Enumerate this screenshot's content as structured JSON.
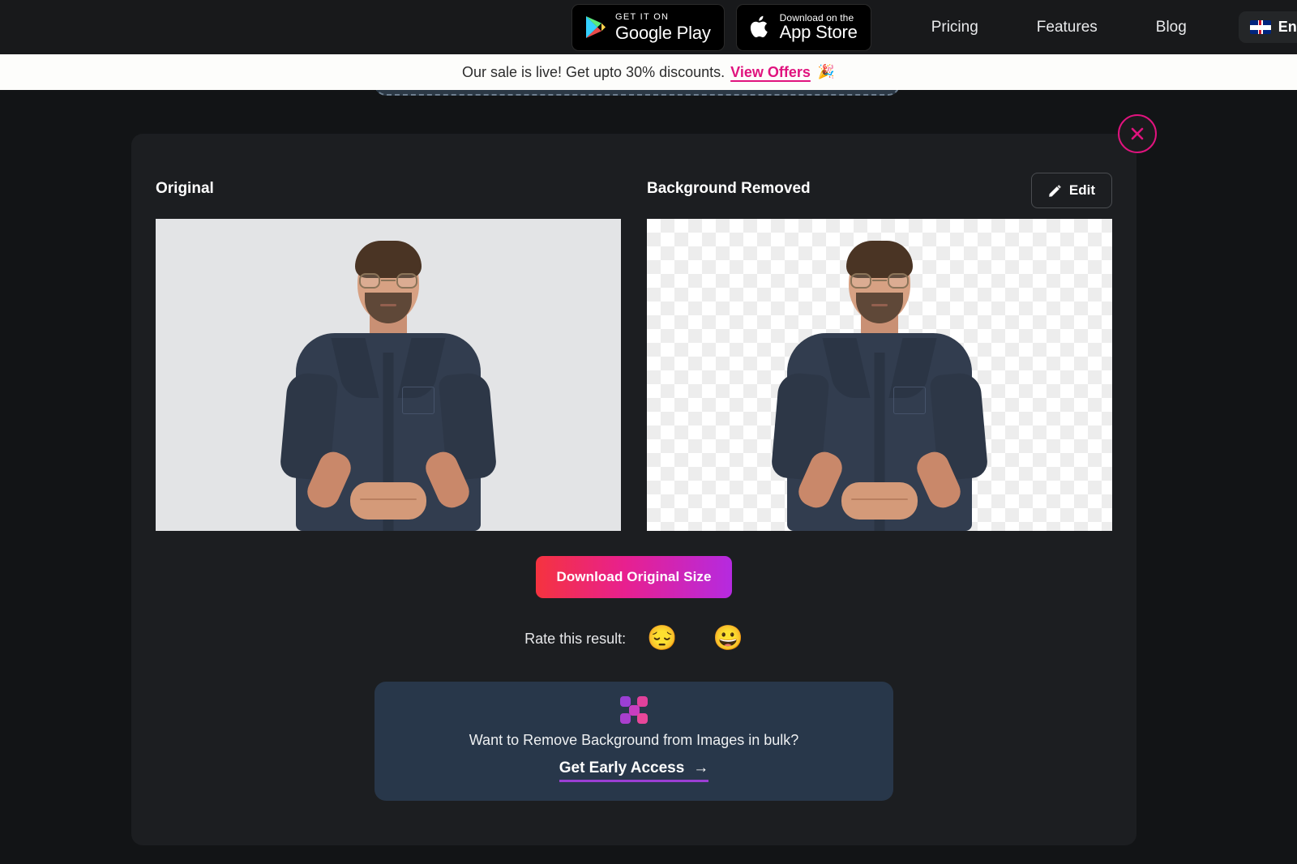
{
  "background": {
    "dropzone_text": "Want to Remove Background from Images in bulk?"
  },
  "topbar": {
    "google_play": {
      "small_label": "GET IT ON",
      "big_label": "Google Play",
      "icon": "google-play-icon"
    },
    "app_store": {
      "small_label": "Download on the",
      "big_label": "App Store",
      "icon": "apple-icon"
    },
    "nav": [
      {
        "label": "Pricing"
      },
      {
        "label": "Features"
      },
      {
        "label": "Blog"
      }
    ],
    "language": {
      "label": "English",
      "flag": "uk-flag-icon"
    }
  },
  "sale_banner": {
    "message": "Our sale is live! Get upto 30% discounts.",
    "link_label": "View Offers",
    "emoji": "🎉",
    "link_color": "#e0137e",
    "background": "#fdfdfb"
  },
  "panel": {
    "close_icon": "close-icon",
    "close_color": "#e0137e",
    "columns": {
      "original_title": "Original",
      "removed_title": "Background Removed"
    },
    "edit_button": {
      "label": "Edit",
      "icon": "pencil-icon"
    },
    "download_button": {
      "label": "Download Original Size",
      "gradient_from": "#f5333f",
      "gradient_to": "#b52ae0"
    },
    "rating": {
      "label": "Rate this result:",
      "options": [
        {
          "name": "sad-emoji",
          "glyph": "😔"
        },
        {
          "name": "happy-emoji",
          "glyph": "😀"
        }
      ]
    },
    "promo": {
      "logo": "bulk-logo-icon",
      "heading": "Want to Remove Background from Images in bulk?",
      "cta_label": "Get Early Access",
      "cta_arrow": "→",
      "background": "#28374a",
      "accent": "#9b3fd4"
    }
  }
}
